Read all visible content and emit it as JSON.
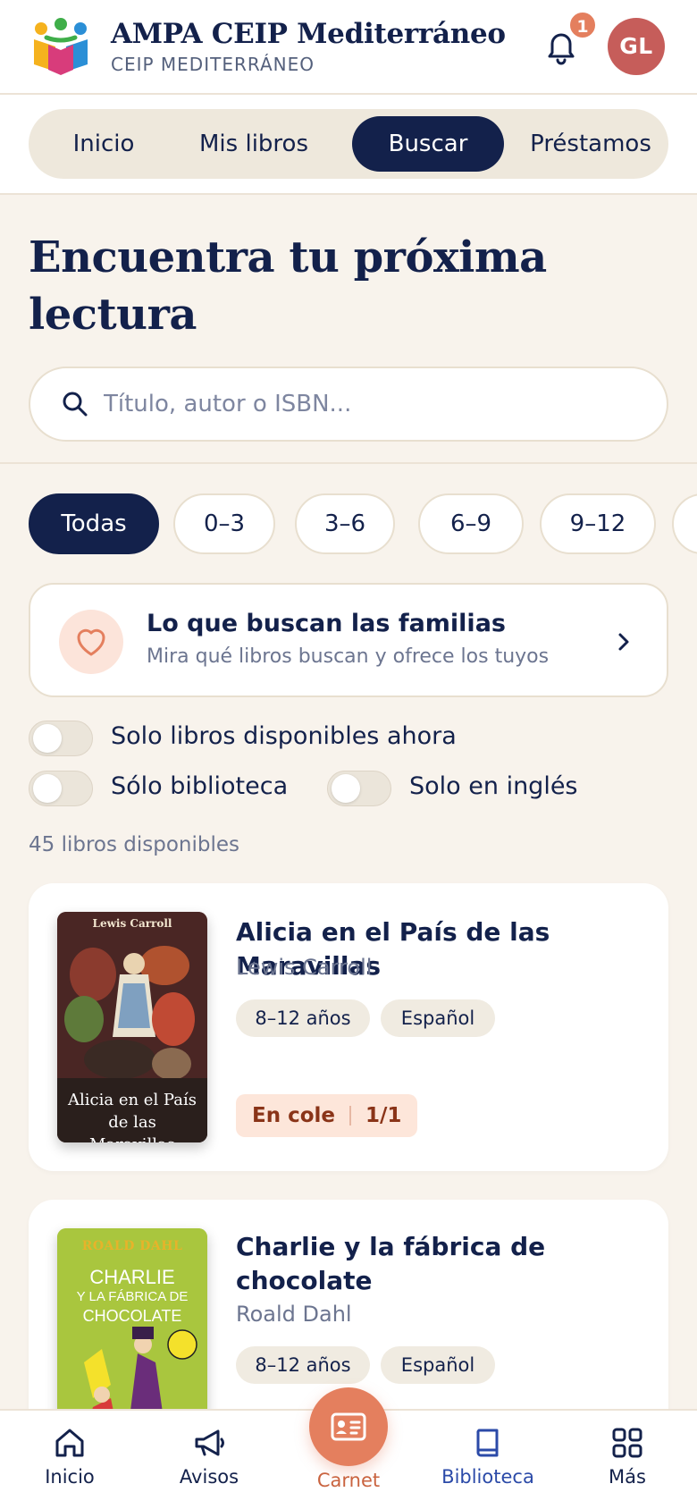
{
  "header": {
    "title": "AMPA CEIP Mediterráneo",
    "subtitle": "CEIP MEDITERRÁNEO",
    "notification_count": "1",
    "avatar_initials": "GL"
  },
  "tabs": [
    {
      "label": "Inicio",
      "active": false
    },
    {
      "label": "Mis libros",
      "active": false
    },
    {
      "label": "Buscar",
      "active": true
    },
    {
      "label": "Préstamos",
      "active": false
    }
  ],
  "hero": {
    "title": "Encuentra tu próxima lectura"
  },
  "search": {
    "placeholder": "Título, autor o ISBN...",
    "value": ""
  },
  "age_filters": [
    {
      "label": "Todas",
      "active": true
    },
    {
      "label": "0–3",
      "active": false
    },
    {
      "label": "3–6",
      "active": false
    },
    {
      "label": "6–9",
      "active": false
    },
    {
      "label": "9–12",
      "active": false
    }
  ],
  "promo": {
    "title": "Lo que buscan las familias",
    "subtitle": "Mira qué libros buscan y ofrece los tuyos"
  },
  "toggles": {
    "available_now": "Solo libros disponibles ahora",
    "library_only": "Sólo biblioteca",
    "english_only": "Solo en inglés"
  },
  "results_count": "45 libros disponibles",
  "books": [
    {
      "title": "Alicia en el País de las Maravillas",
      "author": "Lewis Carroll",
      "age": "8–12 años",
      "language": "Español",
      "status": "En cole",
      "availability": "1/1",
      "cover": {
        "author": "Lewis Carroll",
        "title": "Alicia en el País de las Maravillas"
      }
    },
    {
      "title": "Charlie y la fábrica de chocolate",
      "author": "Roald Dahl",
      "age": "8–12 años",
      "language": "Español",
      "cover": {
        "author": "ROALD DAHL",
        "title_line1": "CHARLIE",
        "title_line2": "Y LA FÁBRICA DE",
        "title_line3": "CHOCOLATE"
      }
    }
  ],
  "bottom_nav": {
    "inicio": "Inicio",
    "avisos": "Avisos",
    "carnet": "Carnet",
    "biblioteca": "Biblioteca",
    "mas": "Más"
  },
  "colors": {
    "navy": "#13214b",
    "accent": "#e47f5e",
    "background": "#f8f3ec",
    "status_bg": "#fde6da",
    "active_nav": "#2b4aa8"
  }
}
